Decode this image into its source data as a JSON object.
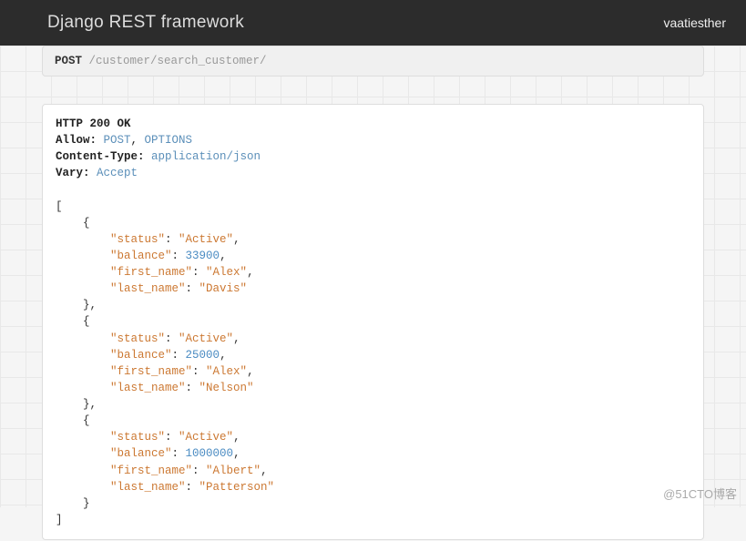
{
  "header": {
    "brand": "Django REST framework",
    "user": "vaatiesther"
  },
  "request": {
    "method": "POST",
    "path": " /customer/search_customer/"
  },
  "response": {
    "status_line": "HTTP 200 OK",
    "headers": [
      {
        "name": "Allow:",
        "values": [
          "POST",
          "OPTIONS"
        ],
        "sep": ", "
      },
      {
        "name": "Content-Type:",
        "values": [
          "application/json"
        ],
        "sep": ""
      },
      {
        "name": "Vary:",
        "values": [
          "Accept"
        ],
        "sep": ""
      }
    ],
    "body_records": [
      {
        "status": "Active",
        "balance": 33900,
        "first_name": "Alex",
        "last_name": "Davis"
      },
      {
        "status": "Active",
        "balance": 25000,
        "first_name": "Alex",
        "last_name": "Nelson"
      },
      {
        "status": "Active",
        "balance": 1000000,
        "first_name": "Albert",
        "last_name": "Patterson"
      }
    ]
  },
  "watermark": "@51CTO博客"
}
